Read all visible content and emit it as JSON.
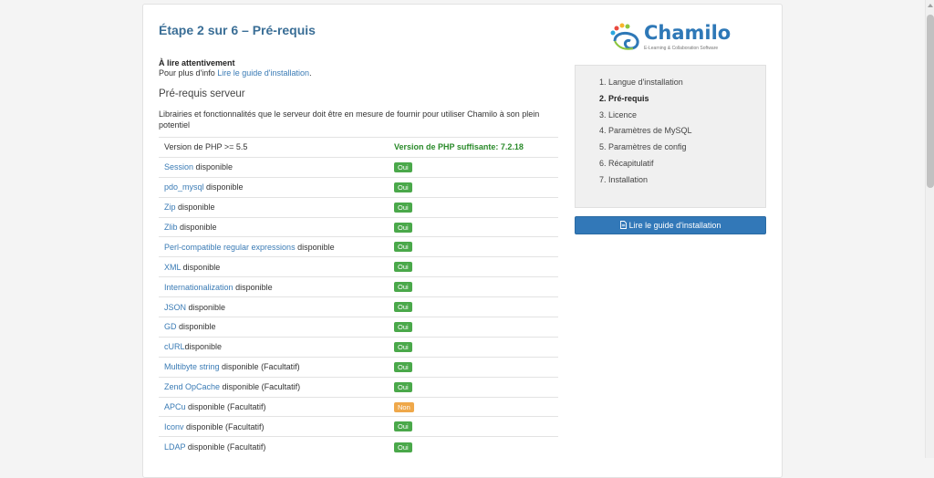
{
  "page": {
    "title": "Étape 2 sur 6 – Pré-requis",
    "note_heading": "À lire attentivement",
    "note_prefix": "Pour plus d'info ",
    "note_link": "Lire le guide d'installation",
    "note_suffix": ".",
    "section_title": "Pré-requis serveur",
    "section_desc": "Librairies et fonctionnalités que le serveur doit être en mesure de fournir pour utiliser Chamilo à son plein potentiel"
  },
  "php": {
    "label": "Version de PHP >= 5.5",
    "status": "Version de PHP suffisante: 7.2.18"
  },
  "requirements": [
    {
      "name": "Session",
      "suffix": " disponible",
      "status": "Oui",
      "ok": true
    },
    {
      "name": "pdo_mysql",
      "suffix": " disponible",
      "status": "Oui",
      "ok": true
    },
    {
      "name": "Zip",
      "suffix": " disponible",
      "status": "Oui",
      "ok": true
    },
    {
      "name": "Zlib",
      "suffix": " disponible",
      "status": "Oui",
      "ok": true
    },
    {
      "name": "Perl-compatible regular expressions",
      "suffix": " disponible",
      "status": "Oui",
      "ok": true
    },
    {
      "name": "XML",
      "suffix": " disponible",
      "status": "Oui",
      "ok": true
    },
    {
      "name": "Internationalization",
      "suffix": " disponible",
      "status": "Oui",
      "ok": true
    },
    {
      "name": "JSON",
      "suffix": " disponible",
      "status": "Oui",
      "ok": true
    },
    {
      "name": "GD",
      "suffix": " disponible",
      "status": "Oui",
      "ok": true
    },
    {
      "name": "cURL",
      "suffix": "disponible",
      "status": "Oui",
      "ok": true
    },
    {
      "name": "Multibyte string",
      "suffix": " disponible (Facultatif)",
      "status": "Oui",
      "ok": true
    },
    {
      "name": "Zend OpCache",
      "suffix": " disponible (Facultatif)",
      "status": "Oui",
      "ok": true
    },
    {
      "name": "APCu",
      "suffix": " disponible (Facultatif)",
      "status": "Non",
      "ok": false
    },
    {
      "name": "Iconv",
      "suffix": " disponible (Facultatif)",
      "status": "Oui",
      "ok": true
    },
    {
      "name": "LDAP",
      "suffix": " disponible (Facultatif)",
      "status": "Oui",
      "ok": true
    }
  ],
  "logo": {
    "name": "Chamilo",
    "tagline": "E-Learning & Collaboration Software"
  },
  "steps": [
    {
      "label": "1. Langue d'installation",
      "active": false
    },
    {
      "label": "2. Pré-requis",
      "active": true
    },
    {
      "label": "3. Licence",
      "active": false
    },
    {
      "label": "4. Paramètres de MySQL",
      "active": false
    },
    {
      "label": "5. Paramètres de config",
      "active": false
    },
    {
      "label": "6. Récapitulatif",
      "active": false
    },
    {
      "label": "7. Installation",
      "active": false
    }
  ],
  "guide_button": {
    "label": "Lire le guide d'installation",
    "icon": "file-text-icon"
  },
  "colors": {
    "ok": "#4aa84a",
    "warn": "#efa84a",
    "primary": "#3278b8",
    "title": "#3a6e96"
  }
}
